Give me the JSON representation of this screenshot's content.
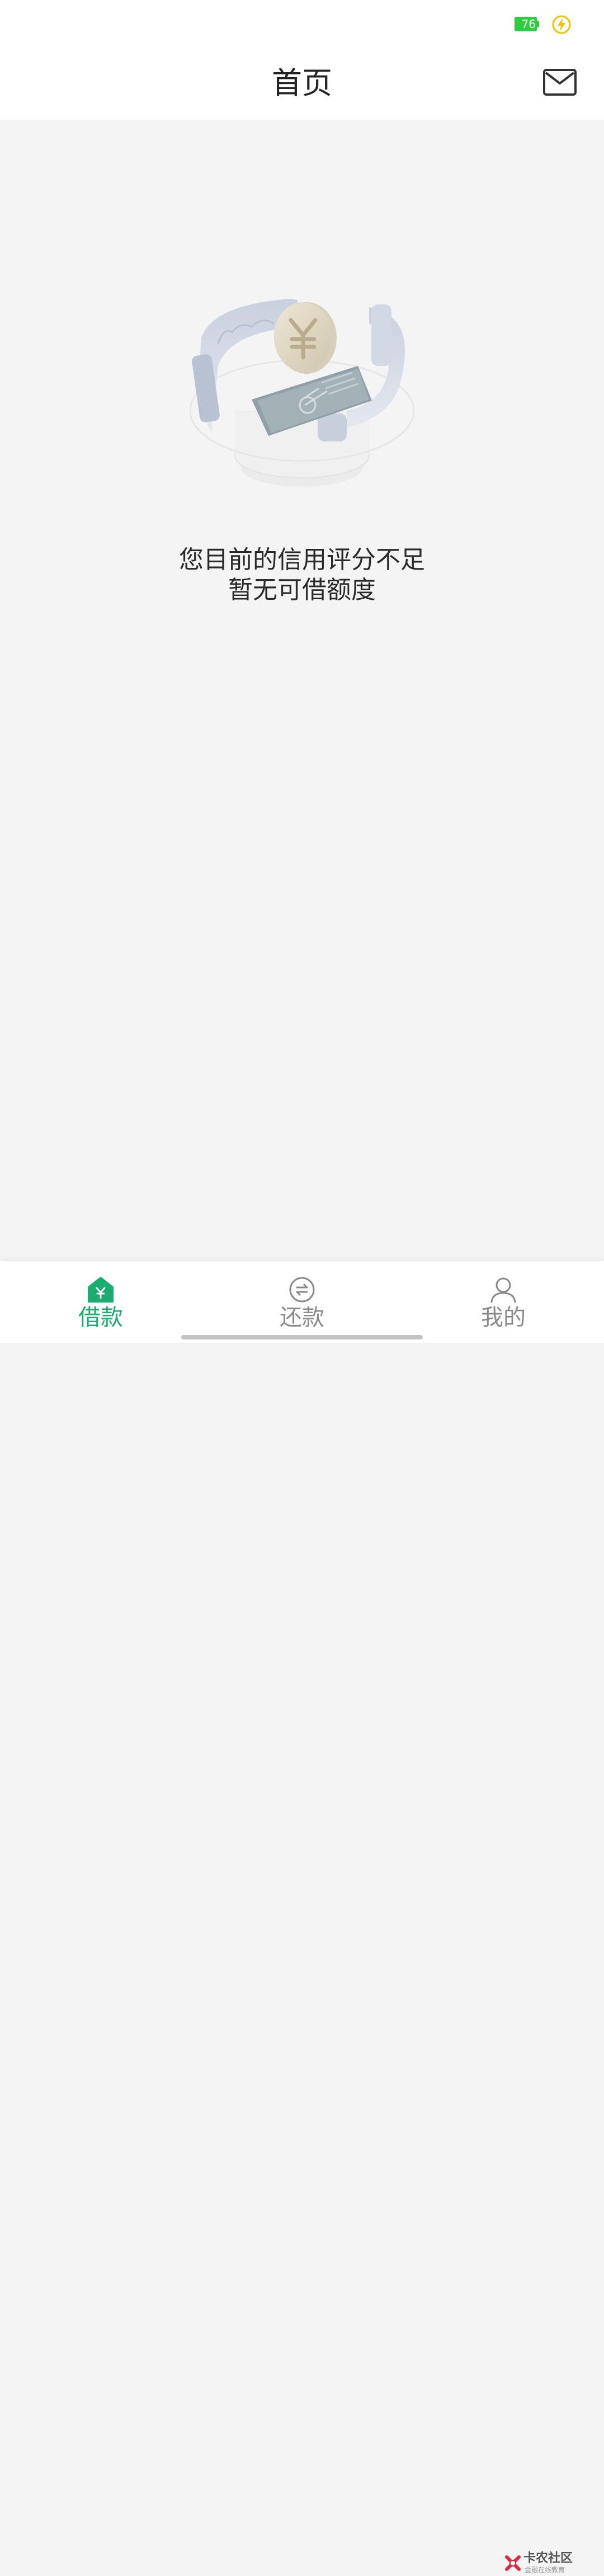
{
  "status_bar": {
    "battery_level": "76",
    "battery_color": "#2ecc40",
    "charging_icon": "lightning-bolt-icon"
  },
  "header": {
    "title": "首页",
    "message_icon": "envelope-icon"
  },
  "main": {
    "illustration_icon": "coin-credit-illustration",
    "message_line1": "您目前的信用评分不足",
    "message_line2": "暂无可借额度"
  },
  "bottom_nav": {
    "active_color": "#1aad6f",
    "inactive_color": "#8a8a8a",
    "items": [
      {
        "label": "借款",
        "icon": "home-yuan-icon",
        "active": true
      },
      {
        "label": "还款",
        "icon": "exchange-circle-icon",
        "active": false
      },
      {
        "label": "我的",
        "icon": "person-icon",
        "active": false
      }
    ]
  },
  "watermark": {
    "title": "卡农社区",
    "subtitle": "金融在线教育"
  }
}
